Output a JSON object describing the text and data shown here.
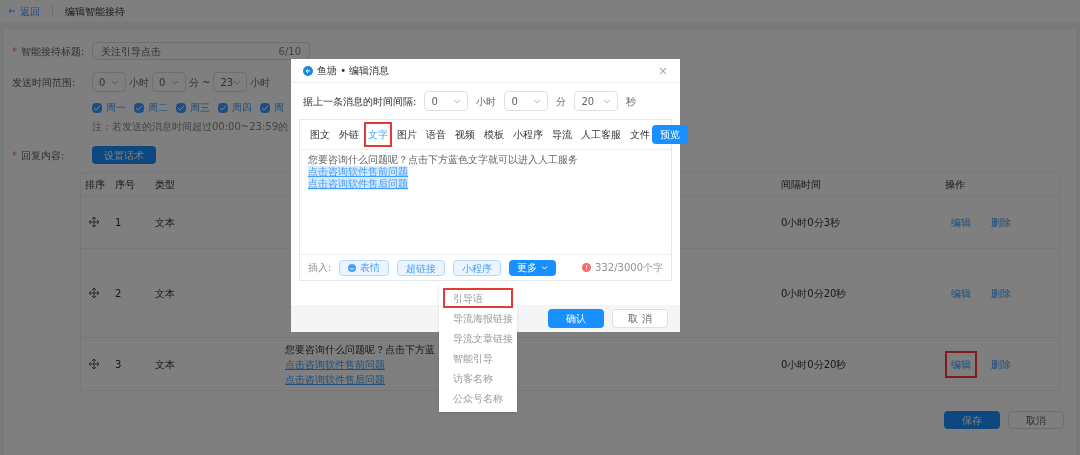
{
  "header": {
    "back": "返回",
    "title": "编辑智能接待"
  },
  "form": {
    "title_label": {
      "mark": "*",
      "text": "智能接待标题:"
    },
    "title_value": "关注引导点击",
    "title_count": "6/10",
    "time_label": {
      "text": "发送时间范围:"
    },
    "time_parts": [
      {
        "kind": "select",
        "value": "0"
      },
      {
        "kind": "text",
        "text": "小时"
      },
      {
        "kind": "select",
        "value": "0"
      },
      {
        "kind": "text",
        "text": "分"
      },
      {
        "kind": "text",
        "text": "~"
      },
      {
        "kind": "select",
        "value": "23"
      },
      {
        "kind": "text",
        "text": "小时"
      }
    ],
    "days": [
      {
        "label": "周一",
        "checked": true
      },
      {
        "label": "周二",
        "checked": true
      },
      {
        "label": "周三",
        "checked": true
      },
      {
        "label": "周四",
        "checked": true
      },
      {
        "label": "周",
        "checked": true
      }
    ],
    "note": "注：若发送的消息时间超过00:00~23:59的",
    "reply_label": {
      "mark": "*",
      "text": "回复内容:"
    },
    "reply_button": "设置话术"
  },
  "table": {
    "columns": [
      "排序",
      "序号",
      "类型",
      "间隔时间",
      "操作"
    ],
    "rows": [
      {
        "index": "1",
        "type": "文本",
        "interval": "0小时0分3秒",
        "actions": [
          {
            "label": "编辑",
            "annotated": false
          },
          {
            "label": "删除",
            "annotated": false
          }
        ]
      },
      {
        "index": "2",
        "type": "文本",
        "interval": "0小时0分20秒",
        "actions": [
          {
            "label": "编辑",
            "annotated": false
          },
          {
            "label": "删除",
            "annotated": false
          }
        ]
      },
      {
        "index": "3",
        "type": "文本",
        "content": {
          "text": "您要咨询什么问题呢？点击下方蓝",
          "links": [
            "点击咨询软件售前问题",
            "点击咨询软件售后问题"
          ]
        },
        "interval": "0小时0分20秒",
        "actions": [
          {
            "label": "编辑",
            "annotated": true
          },
          {
            "label": "删除",
            "annotated": false
          }
        ]
      }
    ]
  },
  "footer_buttons": [
    {
      "kind": "primary",
      "label": "保存"
    },
    {
      "kind": "default",
      "label": "取消"
    }
  ],
  "modal": {
    "title": "鱼塘 • 编辑消息",
    "close": "×",
    "interval_label": "据上一条消息的时间间隔:",
    "interval_parts": [
      {
        "kind": "select",
        "value": "0"
      },
      {
        "kind": "text",
        "text": "小时"
      },
      {
        "kind": "select",
        "value": "0"
      },
      {
        "kind": "text",
        "text": "分"
      },
      {
        "kind": "select",
        "value": "20"
      },
      {
        "kind": "text",
        "text": "秒"
      }
    ],
    "tabs": [
      {
        "label": "图文",
        "selected": false,
        "annotated": false
      },
      {
        "label": "外链",
        "selected": false,
        "annotated": false
      },
      {
        "label": "文字",
        "selected": true,
        "annotated": true
      },
      {
        "label": "图片",
        "selected": false,
        "annotated": false
      },
      {
        "label": "语音",
        "selected": false,
        "annotated": false
      },
      {
        "label": "视频",
        "selected": false,
        "annotated": false
      },
      {
        "label": "模板",
        "selected": false,
        "annotated": false
      },
      {
        "label": "小程序",
        "selected": false,
        "annotated": false
      },
      {
        "label": "导流",
        "selected": false,
        "annotated": false
      },
      {
        "label": "人工客服",
        "selected": false,
        "annotated": false
      },
      {
        "label": "文件",
        "selected": false,
        "annotated": false
      }
    ],
    "preview": "预览",
    "body": {
      "text": "您要咨询什么问题呢？点击下方蓝色文字就可以进入人工服务",
      "links": [
        "点击咨询软件售前问题",
        "点击咨询软件售后问题"
      ]
    },
    "insert_label": "插入:",
    "insert_buttons": [
      {
        "kind": "emoji",
        "label": "表情"
      },
      {
        "kind": "plain",
        "label": "超链接"
      },
      {
        "kind": "plain",
        "label": "小程序"
      },
      {
        "kind": "menu",
        "label": "更多",
        "expanded": true
      }
    ],
    "count": "332/3000个字",
    "confirm": "确认",
    "cancel": "取 消"
  },
  "dropdown": [
    {
      "label": "引导语",
      "annotated": true
    },
    {
      "label": "导流海报链接",
      "annotated": false
    },
    {
      "label": "导流文章链接",
      "annotated": false
    },
    {
      "label": "智能引导",
      "annotated": false
    },
    {
      "label": "访客名称",
      "annotated": false
    },
    {
      "label": "公众号名称",
      "annotated": false
    }
  ]
}
